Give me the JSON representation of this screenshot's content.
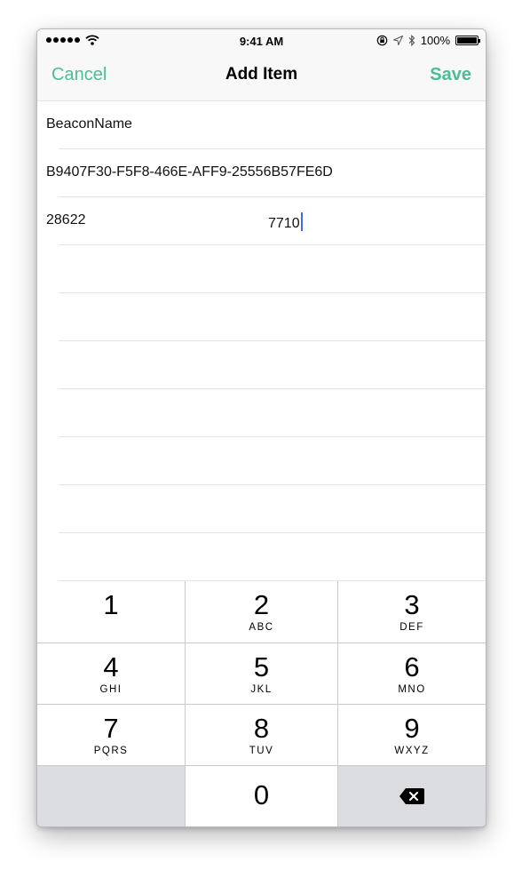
{
  "status_bar": {
    "time": "9:41 AM",
    "battery": "100%",
    "signal_bars": 5,
    "icons": [
      "signal-icon",
      "wifi-icon",
      "lock-rotation-icon",
      "location-icon",
      "bluetooth-icon",
      "battery-icon"
    ]
  },
  "nav": {
    "cancel_label": "Cancel",
    "title": "Add Item",
    "save_label": "Save"
  },
  "form": {
    "name": "BeaconName",
    "uuid": "B9407F30-F5F8-466E-AFF9-25556B57FE6D",
    "major": "28622",
    "minor": "7710"
  },
  "keypad": {
    "keys": [
      {
        "num": "1",
        "letters": ""
      },
      {
        "num": "2",
        "letters": "ABC"
      },
      {
        "num": "3",
        "letters": "DEF"
      },
      {
        "num": "4",
        "letters": "GHI"
      },
      {
        "num": "5",
        "letters": "JKL"
      },
      {
        "num": "6",
        "letters": "MNO"
      },
      {
        "num": "7",
        "letters": "PQRS"
      },
      {
        "num": "8",
        "letters": "TUV"
      },
      {
        "num": "9",
        "letters": "WXYZ"
      },
      {
        "num": "0",
        "letters": ""
      }
    ]
  },
  "colors": {
    "accent": "#4cbd96",
    "caret": "#4468e6",
    "keypad_gray": "#dcdde1"
  }
}
